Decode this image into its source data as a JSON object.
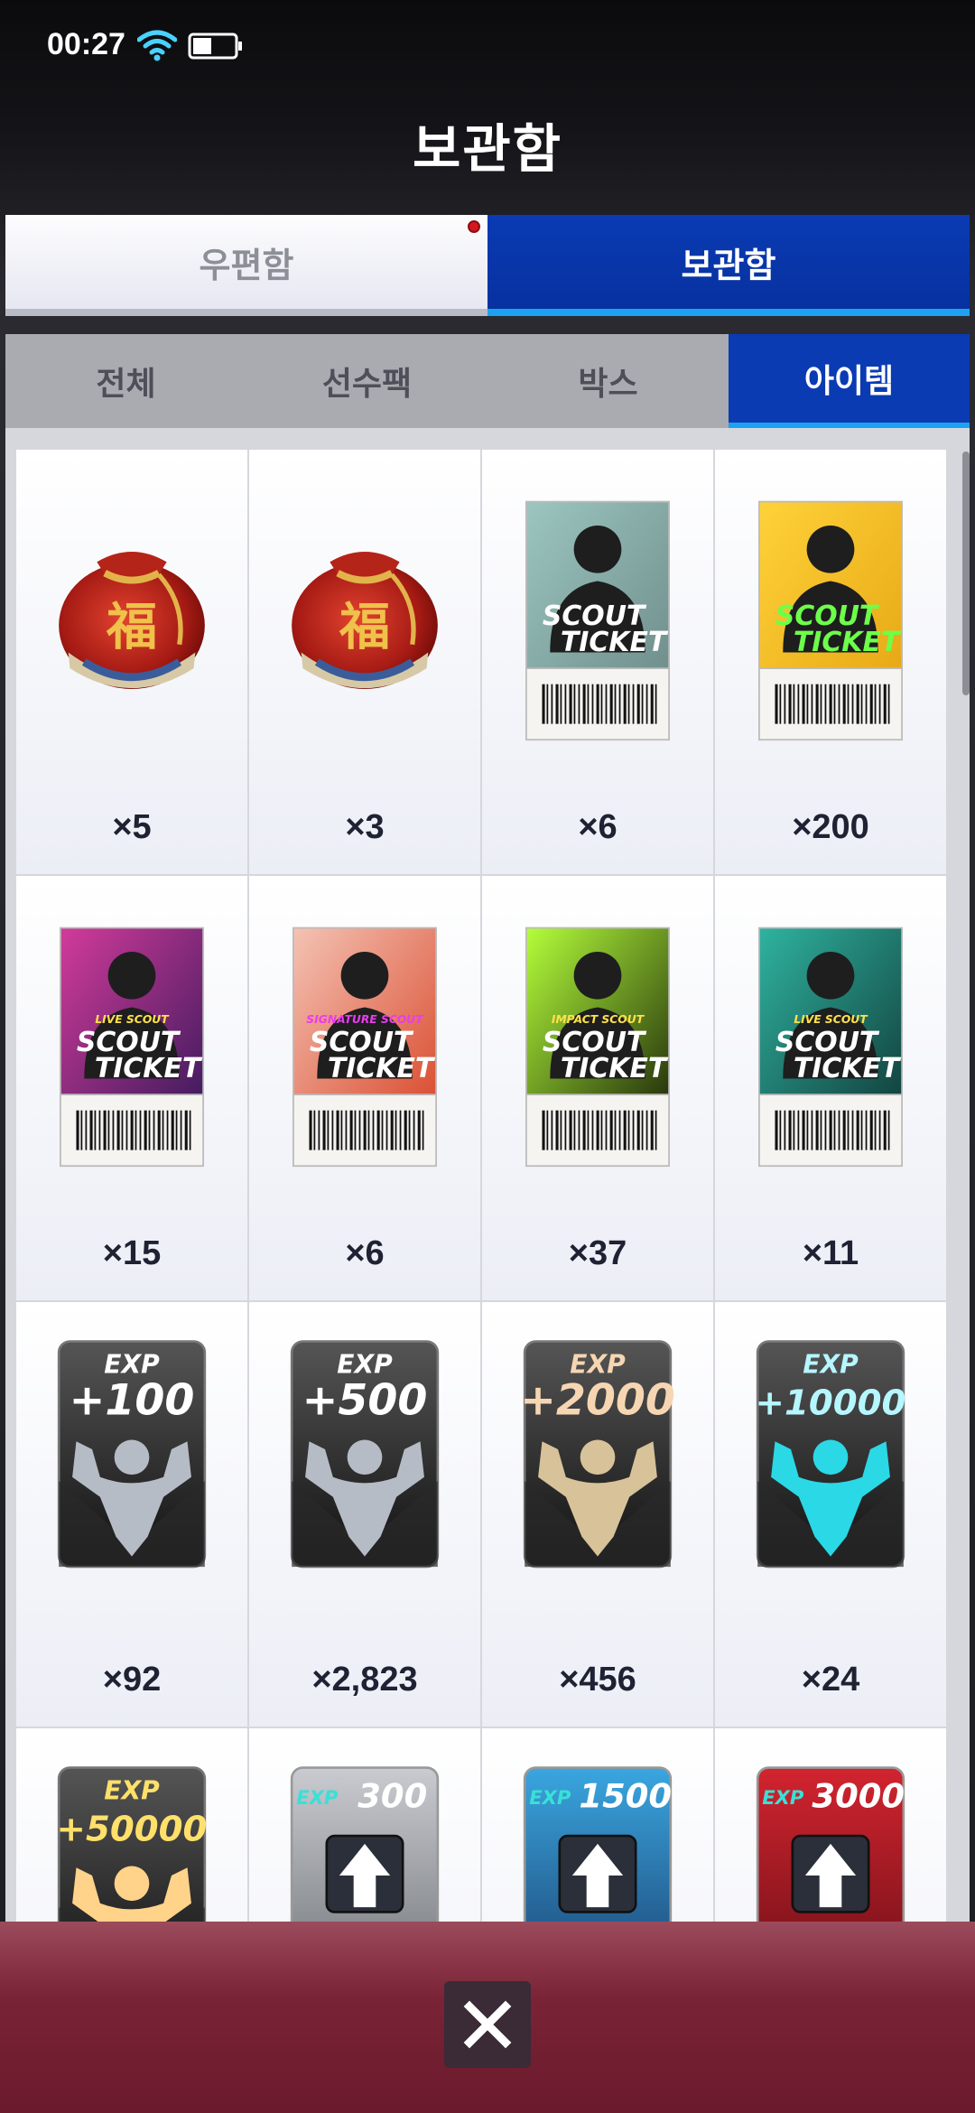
{
  "status": {
    "time": "00:27"
  },
  "header": {
    "title": "보관함"
  },
  "top_tabs": [
    {
      "label": "우편함",
      "active": false,
      "has_notification": true
    },
    {
      "label": "보관함",
      "active": true,
      "has_notification": false
    }
  ],
  "sub_tabs": [
    {
      "label": "전체",
      "active": false
    },
    {
      "label": "선수팩",
      "active": false
    },
    {
      "label": "박스",
      "active": false
    },
    {
      "label": "아이템",
      "active": true
    }
  ],
  "items": [
    {
      "name": "lucky-bag-icon",
      "qty": "×5"
    },
    {
      "name": "lucky-bag-icon",
      "qty": "×3"
    },
    {
      "name": "scout-ticket-icon",
      "qty": "×6",
      "ticket_text": [
        "SCOUT",
        "TICKET"
      ]
    },
    {
      "name": "gold-scout-ticket-icon",
      "qty": "×200",
      "ticket_text": [
        "SCOUT",
        "TICKET"
      ]
    },
    {
      "name": "live-scout-ticket-icon",
      "qty": "×15",
      "ticket_tag": "LIVE SCOUT",
      "ticket_text": [
        "SCOUT",
        "TICKET"
      ]
    },
    {
      "name": "signature-scout-ticket-icon",
      "qty": "×6",
      "ticket_tag": "SIGNATURE SCOUT",
      "ticket_text": [
        "SCOUT",
        "TICKET"
      ]
    },
    {
      "name": "impact-scout-ticket-icon",
      "qty": "×37",
      "ticket_tag": "IMPACT SCOUT",
      "ticket_text": [
        "SCOUT",
        "TICKET"
      ]
    },
    {
      "name": "live-scout-ticket-icon",
      "qty": "×11",
      "ticket_tag": "LIVE SCOUT",
      "ticket_text": [
        "SCOUT",
        "TICKET"
      ]
    },
    {
      "name": "exp-100-card-icon",
      "qty": "×92",
      "exp_label": "EXP",
      "exp_value": "+100"
    },
    {
      "name": "exp-500-card-icon",
      "qty": "×2,823",
      "exp_label": "EXP",
      "exp_value": "+500"
    },
    {
      "name": "exp-2000-card-icon",
      "qty": "×456",
      "exp_label": "EXP",
      "exp_value": "+2000"
    },
    {
      "name": "exp-10000-card-icon",
      "qty": "×24",
      "exp_label": "EXP",
      "exp_value": "+10000"
    },
    {
      "name": "exp-50000-card-icon",
      "qty": "",
      "exp_label": "EXP",
      "exp_value": "+50000"
    },
    {
      "name": "exp-300-upgrade-icon",
      "qty": "",
      "exp_label": "EXP",
      "exp_value": "300"
    },
    {
      "name": "exp-1500-upgrade-icon",
      "qty": "",
      "exp_label": "EXP",
      "exp_value": "1500"
    },
    {
      "name": "exp-3000-upgrade-icon",
      "qty": "",
      "exp_label": "EXP",
      "exp_value": "3000"
    }
  ],
  "colors": {
    "tab_active": "#0a3bb3",
    "tab_accent": "#1da2f1",
    "notify_dot": "#d4161e",
    "bottom_bar": "#7a2336"
  }
}
